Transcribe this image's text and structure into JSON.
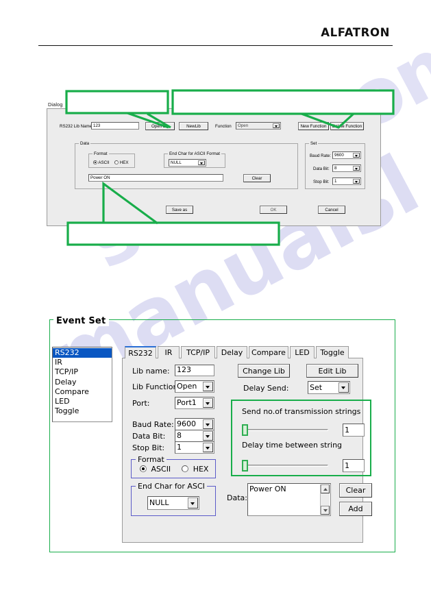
{
  "page": {
    "brand": "ALFATRON"
  },
  "dialog": {
    "title": "Dialog",
    "lib_name_label": "RS232 Lib Name:",
    "lib_name_value": "123",
    "open_lib_label": "Open Lib",
    "new_lib_label": "NewLib",
    "function_label": "Function",
    "function_value": "Open",
    "new_function_label": "New Function",
    "delete_function_label": "Delete Function",
    "data_group_legend": "Data",
    "format_group_legend": "Format",
    "format_ascii_label": "ASCII",
    "format_hex_label": "HEX",
    "format_selected": "ASCII",
    "endchar_group_legend": "End Char for ASCII Format",
    "endchar_value": "NULL",
    "data_value": "Power ON",
    "clear_label": "Clear",
    "set_group_legend": "Set",
    "baud_rate_label": "Baud Rate:",
    "baud_rate_value": "9600",
    "data_bit_label": "Data Bit:",
    "data_bit_value": "8",
    "stop_bit_label": "Stop Bit:",
    "stop_bit_value": "1",
    "save_as_label": "Save as",
    "ok_label": "OK",
    "cancel_label": "Cancel"
  },
  "event_set": {
    "legend": "Event Set",
    "list_items": [
      {
        "label": "RS232",
        "selected": true
      },
      {
        "label": "IR",
        "selected": false
      },
      {
        "label": "TCP/IP",
        "selected": false
      },
      {
        "label": "Delay",
        "selected": false
      },
      {
        "label": "Compare",
        "selected": false
      },
      {
        "label": "LED",
        "selected": false
      },
      {
        "label": "Toggle",
        "selected": false
      }
    ],
    "tabs": [
      {
        "label": "RS232",
        "active": true
      },
      {
        "label": "IR",
        "active": false
      },
      {
        "label": "TCP/IP",
        "active": false
      },
      {
        "label": "Delay",
        "active": false
      },
      {
        "label": "Compare",
        "active": false
      },
      {
        "label": "LED",
        "active": false
      },
      {
        "label": "Toggle",
        "active": false
      }
    ],
    "lib_name_label": "Lib name:",
    "lib_name_value": "123",
    "lib_function_label": "Lib Function:",
    "lib_function_value": "Open",
    "port_label": "Port:",
    "port_value": "Port1",
    "baud_rate_label": "Baud Rate:",
    "baud_rate_value": "9600",
    "data_bit_label": "Data Bit:",
    "data_bit_value": "8",
    "stop_bit_label": "Stop Bit:",
    "stop_bit_value": "1",
    "format_group_legend": "Format",
    "format_ascii_label": "ASCII",
    "format_hex_label": "HEX",
    "format_selected": "ASCII",
    "endchar_group_legend": "End Char for ASCI",
    "endchar_value": "NULL",
    "change_lib_label": "Change Lib",
    "edit_lib_label": "Edit Lib",
    "delay_send_label": "Delay Send:",
    "delay_send_value": "Set",
    "send_count_label": "Send no.of transmission strings",
    "send_count_value": "1",
    "delay_time_label": "Delay time between string",
    "delay_time_value": "1",
    "data_label": "Data:",
    "data_value": "Power ON",
    "clear_label": "Clear",
    "add_label": "Add"
  },
  "watermark": {
    "line1": "manualsl",
    "line2": "shive.com"
  },
  "colors": {
    "accent_green": "#18ad4a",
    "select_blue": "#0a57c2",
    "group_blue": "#5a5ac8",
    "dialog_face": "#ececec"
  }
}
